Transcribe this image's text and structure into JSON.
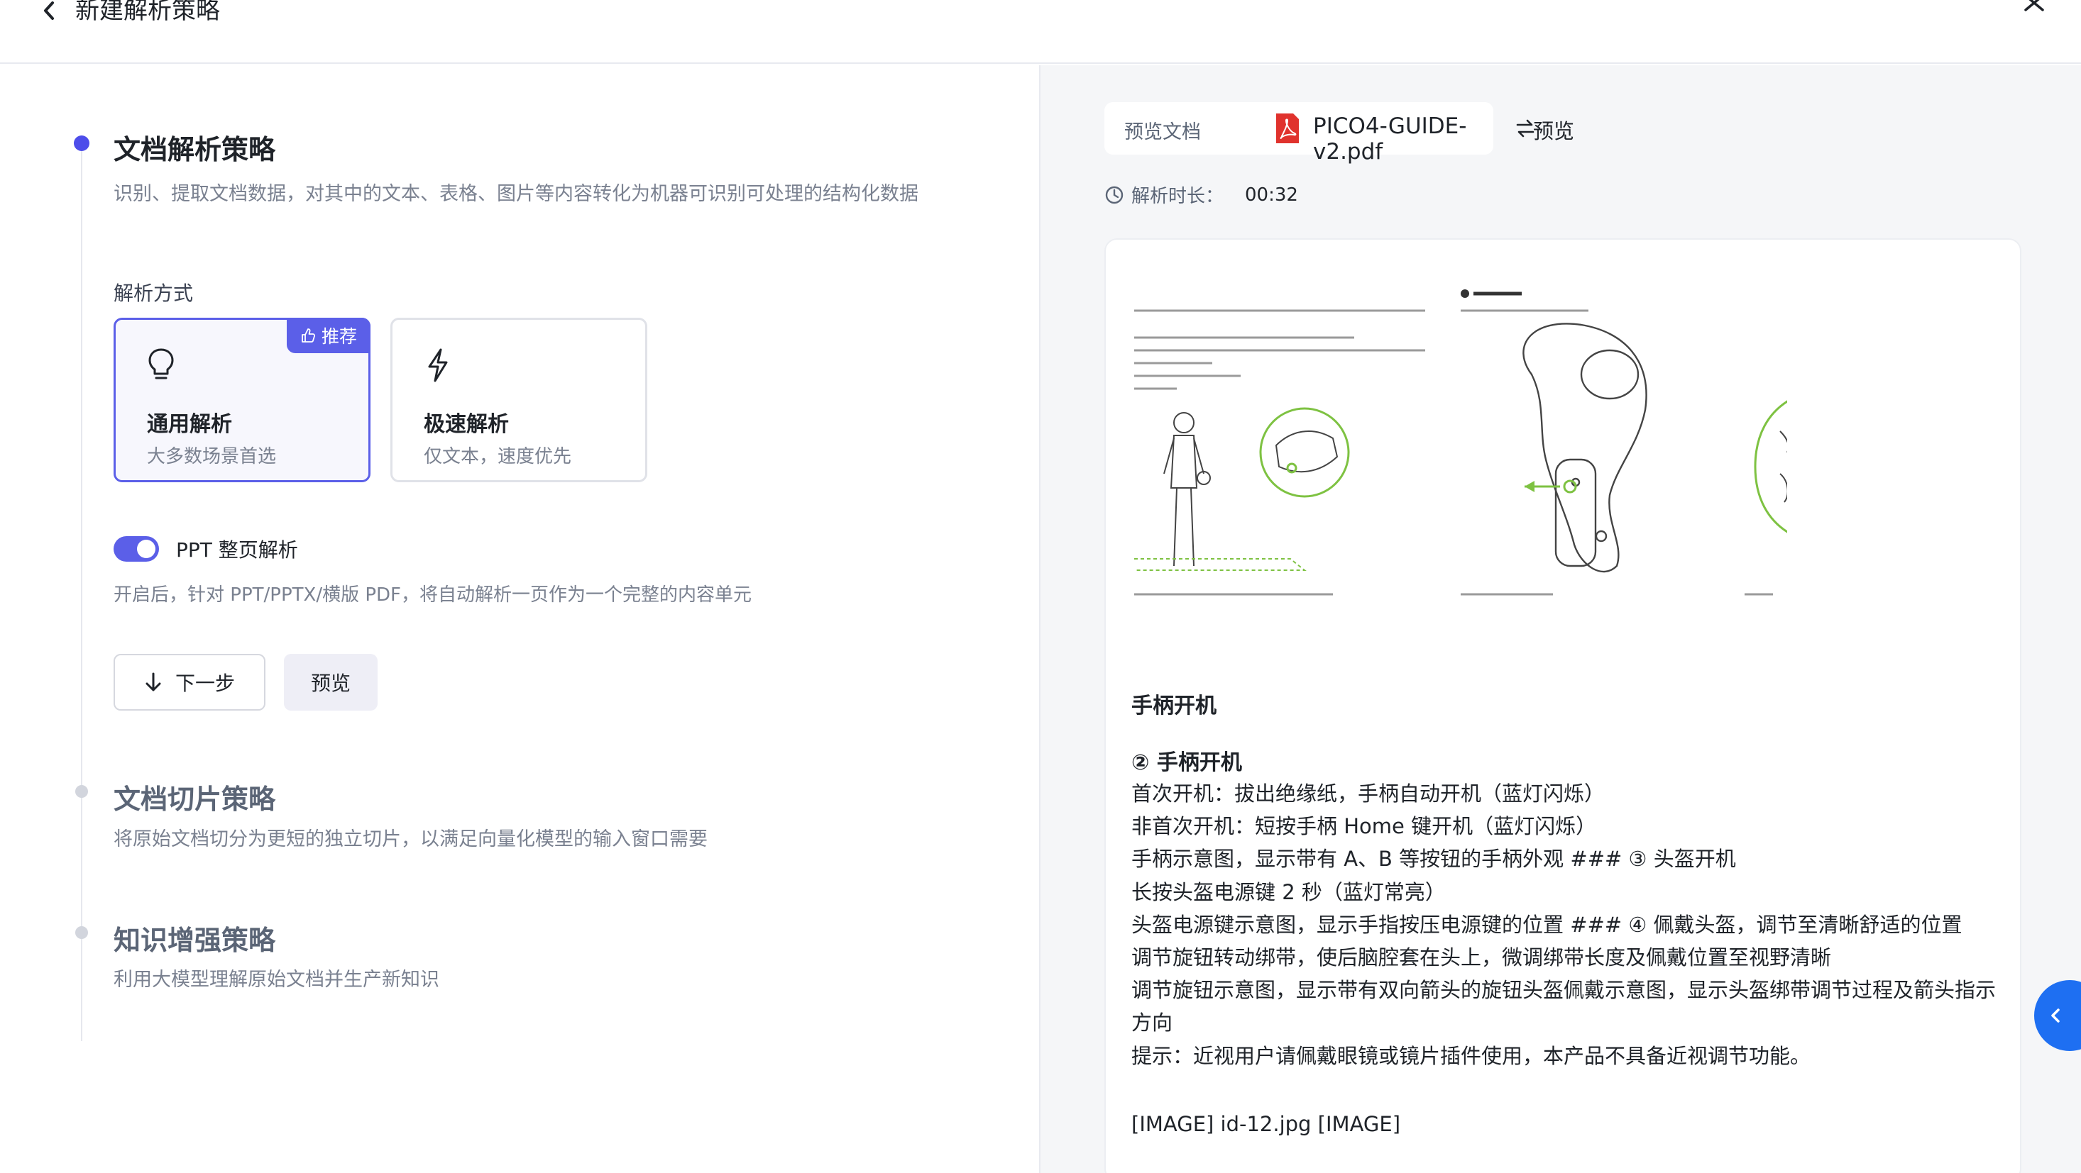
{
  "header": {
    "title": "新建解析策略"
  },
  "steps": [
    {
      "title": "文档解析策略",
      "desc": "识别、提取文档数据，对其中的文本、表格、图片等内容转化为机器可识别可处理的结构化数据"
    },
    {
      "title": "文档切片策略",
      "desc": "将原始文档切分为更短的独立切片，以满足向量化模型的输入窗口需要"
    },
    {
      "title": "知识增强策略",
      "desc": "利用大模型理解原始文档并生产新知识"
    }
  ],
  "parse_mode": {
    "label": "解析方式",
    "options": [
      {
        "title": "通用解析",
        "sub": "大多数场景首选",
        "badge": "推荐",
        "icon": "lightbulb-icon",
        "selected": true
      },
      {
        "title": "极速解析",
        "sub": "仅文本，速度优先",
        "icon": "lightning-icon",
        "selected": false
      }
    ]
  },
  "ppt_toggle": {
    "label": "PPT 整页解析",
    "on": true,
    "desc": "开启后，针对 PPT/PPTX/横版 PDF，将自动解析一页作为一个完整的内容单元"
  },
  "buttons": {
    "next": "下一步",
    "preview": "预览"
  },
  "right": {
    "doc_label": "预览文档",
    "file_name": "PICO4-GUIDE-v2.pdf",
    "preview": "预览",
    "duration_label": "解析时长：",
    "duration_value": "00:32",
    "content": {
      "heading1": "手柄开机",
      "heading2": "② 手柄开机",
      "lines": [
        "首次开机：拔出绝缘纸，手柄自动开机（蓝灯闪烁）",
        "非首次开机：短按手柄 Home 键开机（蓝灯闪烁）",
        "手柄示意图，显示带有 A、B 等按钮的手柄外观 ### ③ 头盔开机",
        "长按头盔电源键 2 秒（蓝灯常亮）",
        "头盔电源键示意图，显示手指按压电源键的位置 ### ④ 佩戴头盔，调节至清晰舒适的位置",
        "调节旋钮转动绑带，使后脑腔套在头上，微调绑带长度及佩戴位置至视野清晰",
        "调节旋钮示意图，显示带有双向箭头的旋钮头盔佩戴示意图，显示头盔绑带调节过程及箭头指示方向",
        "提示：近视用户请佩戴眼镜或镜片插件使用，本产品不具备近视调节功能。"
      ],
      "image_tag": "[IMAGE] id-12.jpg [IMAGE]"
    }
  },
  "colors": {
    "accent": "#5b5fe8",
    "side_tab": "#1e6ff2",
    "pdf_red": "#e0322d",
    "illustration_green": "#7ec242"
  }
}
